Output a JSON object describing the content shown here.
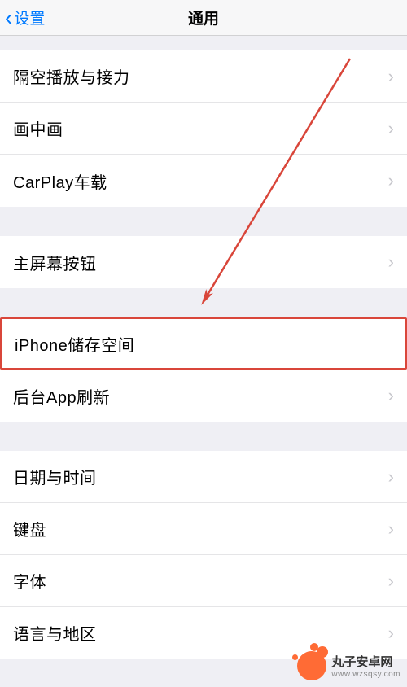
{
  "nav": {
    "back_label": "设置",
    "title": "通用"
  },
  "sections": [
    {
      "items": [
        {
          "label": "隔空播放与接力"
        },
        {
          "label": "画中画"
        },
        {
          "label": "CarPlay车载"
        }
      ]
    },
    {
      "items": [
        {
          "label": "主屏幕按钮"
        }
      ]
    },
    {
      "items": [
        {
          "label": "iPhone储存空间",
          "highlighted": true
        },
        {
          "label": "后台App刷新"
        }
      ]
    },
    {
      "items": [
        {
          "label": "日期与时间"
        },
        {
          "label": "键盘"
        },
        {
          "label": "字体"
        },
        {
          "label": "语言与地区"
        }
      ]
    }
  ],
  "watermark": {
    "name": "丸子安卓网",
    "url": "www.wzsqsy.com"
  },
  "annotation": {
    "arrow_color": "#d9463a",
    "highlight_color": "#d9463a"
  }
}
